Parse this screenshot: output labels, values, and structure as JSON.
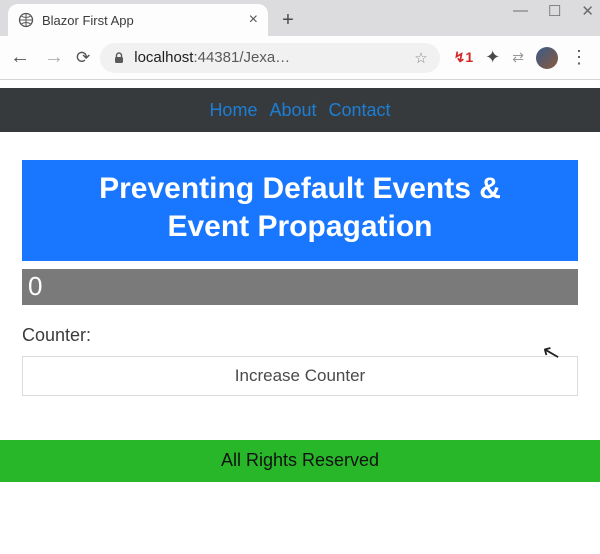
{
  "browser": {
    "tab_title": "Blazor First App",
    "address_host": "localhost",
    "address_port_path": ":44381/Jexa…",
    "window_controls": {
      "min": "—",
      "max": "☐",
      "close": "✕"
    },
    "newtab": "+"
  },
  "navbar": {
    "items": [
      "Home",
      "About",
      "Contact"
    ]
  },
  "hero": {
    "line1": "Preventing Default Events &",
    "line2": "Event Propagation"
  },
  "input": {
    "value": "0"
  },
  "counter": {
    "label": "Counter:",
    "button": "Increase Counter"
  },
  "footer": {
    "text": "All Rights Reserved"
  }
}
